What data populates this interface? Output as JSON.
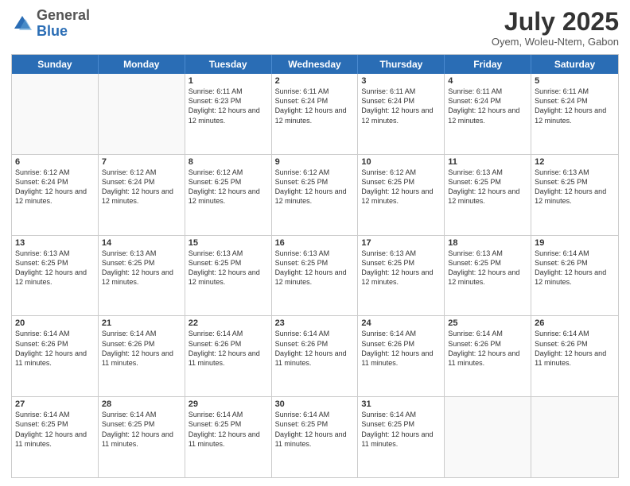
{
  "logo": {
    "general": "General",
    "blue": "Blue"
  },
  "header": {
    "month": "July 2025",
    "location": "Oyem, Woleu-Ntem, Gabon"
  },
  "days": [
    "Sunday",
    "Monday",
    "Tuesday",
    "Wednesday",
    "Thursday",
    "Friday",
    "Saturday"
  ],
  "weeks": [
    [
      {
        "num": "",
        "info": ""
      },
      {
        "num": "",
        "info": ""
      },
      {
        "num": "1",
        "info": "Sunrise: 6:11 AM\nSunset: 6:23 PM\nDaylight: 12 hours and 12 minutes."
      },
      {
        "num": "2",
        "info": "Sunrise: 6:11 AM\nSunset: 6:24 PM\nDaylight: 12 hours and 12 minutes."
      },
      {
        "num": "3",
        "info": "Sunrise: 6:11 AM\nSunset: 6:24 PM\nDaylight: 12 hours and 12 minutes."
      },
      {
        "num": "4",
        "info": "Sunrise: 6:11 AM\nSunset: 6:24 PM\nDaylight: 12 hours and 12 minutes."
      },
      {
        "num": "5",
        "info": "Sunrise: 6:11 AM\nSunset: 6:24 PM\nDaylight: 12 hours and 12 minutes."
      }
    ],
    [
      {
        "num": "6",
        "info": "Sunrise: 6:12 AM\nSunset: 6:24 PM\nDaylight: 12 hours and 12 minutes."
      },
      {
        "num": "7",
        "info": "Sunrise: 6:12 AM\nSunset: 6:24 PM\nDaylight: 12 hours and 12 minutes."
      },
      {
        "num": "8",
        "info": "Sunrise: 6:12 AM\nSunset: 6:25 PM\nDaylight: 12 hours and 12 minutes."
      },
      {
        "num": "9",
        "info": "Sunrise: 6:12 AM\nSunset: 6:25 PM\nDaylight: 12 hours and 12 minutes."
      },
      {
        "num": "10",
        "info": "Sunrise: 6:12 AM\nSunset: 6:25 PM\nDaylight: 12 hours and 12 minutes."
      },
      {
        "num": "11",
        "info": "Sunrise: 6:13 AM\nSunset: 6:25 PM\nDaylight: 12 hours and 12 minutes."
      },
      {
        "num": "12",
        "info": "Sunrise: 6:13 AM\nSunset: 6:25 PM\nDaylight: 12 hours and 12 minutes."
      }
    ],
    [
      {
        "num": "13",
        "info": "Sunrise: 6:13 AM\nSunset: 6:25 PM\nDaylight: 12 hours and 12 minutes."
      },
      {
        "num": "14",
        "info": "Sunrise: 6:13 AM\nSunset: 6:25 PM\nDaylight: 12 hours and 12 minutes."
      },
      {
        "num": "15",
        "info": "Sunrise: 6:13 AM\nSunset: 6:25 PM\nDaylight: 12 hours and 12 minutes."
      },
      {
        "num": "16",
        "info": "Sunrise: 6:13 AM\nSunset: 6:25 PM\nDaylight: 12 hours and 12 minutes."
      },
      {
        "num": "17",
        "info": "Sunrise: 6:13 AM\nSunset: 6:25 PM\nDaylight: 12 hours and 12 minutes."
      },
      {
        "num": "18",
        "info": "Sunrise: 6:13 AM\nSunset: 6:25 PM\nDaylight: 12 hours and 12 minutes."
      },
      {
        "num": "19",
        "info": "Sunrise: 6:14 AM\nSunset: 6:26 PM\nDaylight: 12 hours and 12 minutes."
      }
    ],
    [
      {
        "num": "20",
        "info": "Sunrise: 6:14 AM\nSunset: 6:26 PM\nDaylight: 12 hours and 11 minutes."
      },
      {
        "num": "21",
        "info": "Sunrise: 6:14 AM\nSunset: 6:26 PM\nDaylight: 12 hours and 11 minutes."
      },
      {
        "num": "22",
        "info": "Sunrise: 6:14 AM\nSunset: 6:26 PM\nDaylight: 12 hours and 11 minutes."
      },
      {
        "num": "23",
        "info": "Sunrise: 6:14 AM\nSunset: 6:26 PM\nDaylight: 12 hours and 11 minutes."
      },
      {
        "num": "24",
        "info": "Sunrise: 6:14 AM\nSunset: 6:26 PM\nDaylight: 12 hours and 11 minutes."
      },
      {
        "num": "25",
        "info": "Sunrise: 6:14 AM\nSunset: 6:26 PM\nDaylight: 12 hours and 11 minutes."
      },
      {
        "num": "26",
        "info": "Sunrise: 6:14 AM\nSunset: 6:26 PM\nDaylight: 12 hours and 11 minutes."
      }
    ],
    [
      {
        "num": "27",
        "info": "Sunrise: 6:14 AM\nSunset: 6:25 PM\nDaylight: 12 hours and 11 minutes."
      },
      {
        "num": "28",
        "info": "Sunrise: 6:14 AM\nSunset: 6:25 PM\nDaylight: 12 hours and 11 minutes."
      },
      {
        "num": "29",
        "info": "Sunrise: 6:14 AM\nSunset: 6:25 PM\nDaylight: 12 hours and 11 minutes."
      },
      {
        "num": "30",
        "info": "Sunrise: 6:14 AM\nSunset: 6:25 PM\nDaylight: 12 hours and 11 minutes."
      },
      {
        "num": "31",
        "info": "Sunrise: 6:14 AM\nSunset: 6:25 PM\nDaylight: 12 hours and 11 minutes."
      },
      {
        "num": "",
        "info": ""
      },
      {
        "num": "",
        "info": ""
      }
    ]
  ]
}
